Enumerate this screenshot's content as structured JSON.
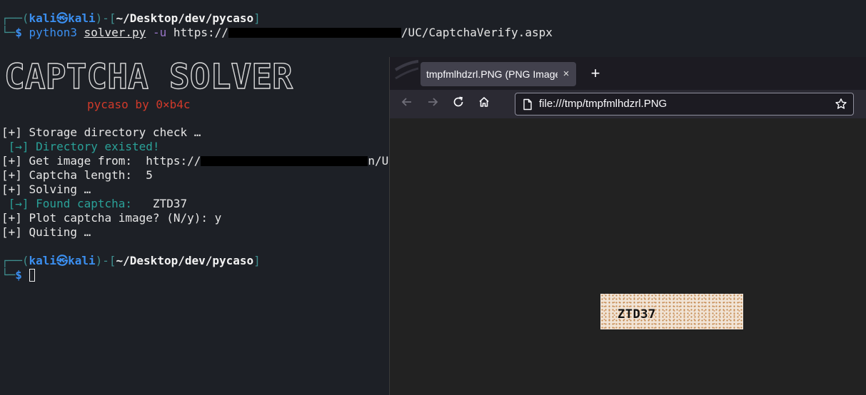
{
  "prompt": {
    "open_paren": "┌──(",
    "user": "kali",
    "at_icon": "㉿",
    "host": "kali",
    "mid": ")-[",
    "path": "~/Desktop/dev/pycaso",
    "close": "]",
    "arrow": "└─",
    "dollar": "$ "
  },
  "command": {
    "program": "python3",
    "script": "solver.py",
    "flag": "-u",
    "url_prefix": "https://",
    "url_suffix": "/UC/CaptchaVerify.aspx"
  },
  "banner": {
    "title": "CAPTCHA SOLVER",
    "byline": "pycaso by 0×b4c"
  },
  "output": [
    {
      "prefix": "[+]",
      "text": " Storage directory check …"
    },
    {
      "prefix": " [→]",
      "text": " Directory existed!"
    },
    {
      "prefix": "[+]",
      "text": " Get image from:  https://",
      "tail": "n/U"
    },
    {
      "prefix": "[+]",
      "text": " Captcha length:  5"
    },
    {
      "prefix": "[+]",
      "text": " Solving …"
    },
    {
      "prefix": " [→]",
      "text": " Found captcha:   ",
      "value": "ZTD37"
    },
    {
      "prefix": "[+]",
      "text": " Plot captcha image? (N/y): y"
    },
    {
      "prefix": "[+]",
      "text": " Quiting …"
    }
  ],
  "browser": {
    "tab_title": "tmpfmlhdzrl.PNG (PNG Image",
    "tab_close": "×",
    "new_tab": "+",
    "url": "file:///tmp/tmpfmlhdzrl.PNG",
    "captcha_text": "ZTD37"
  },
  "colors": {
    "terminal_bg": "#1d2026",
    "prompt_frame": "#3f8f8f",
    "user_blue": "#3b8ff0",
    "success_teal": "#2aa198",
    "banner_red": "#d23a2a",
    "browser_tabbar": "#1c1b22",
    "browser_navbar": "#2b2a33"
  }
}
